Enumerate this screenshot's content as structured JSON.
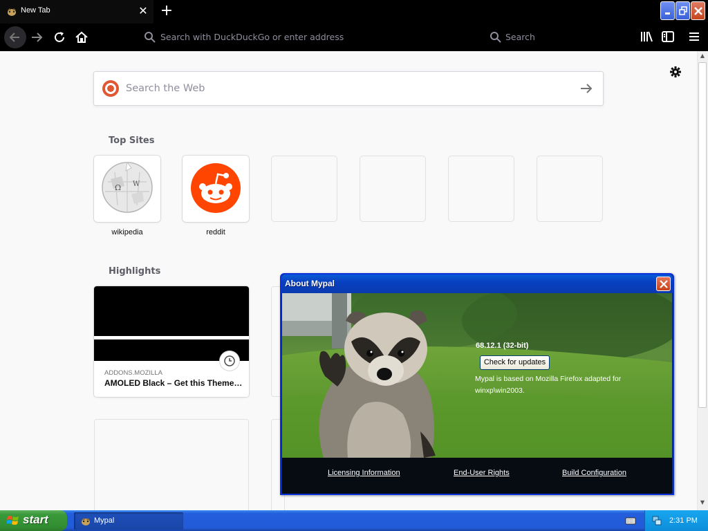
{
  "browser": {
    "tab_title": "New Tab",
    "urlbar_placeholder": "Search with DuckDuckGo or enter address",
    "searchbar_placeholder": "Search",
    "icons": [
      "back-icon",
      "forward-icon",
      "reload-icon",
      "home-icon",
      "library-icon",
      "sidebar-icon",
      "menu-icon"
    ]
  },
  "newtab": {
    "search_placeholder": "Search the Web",
    "top_sites_title": "Top Sites",
    "highlights_title": "Highlights",
    "top_sites": [
      {
        "label": "wikipedia"
      },
      {
        "label": "reddit"
      },
      {
        "label": ""
      },
      {
        "label": ""
      },
      {
        "label": ""
      },
      {
        "label": ""
      }
    ],
    "highlight_card": {
      "source": "ADDONS.MOZILLA",
      "title": "AMOLED Black – Get this Theme…"
    }
  },
  "about_dialog": {
    "title": "About Mypal",
    "version": "68.12.1 (32-bit)",
    "check_button": "Check for updates",
    "description": "Mypal is based on Mozilla Firefox adapted for winxp\\win2003.",
    "links": [
      "Licensing Information",
      "End-User Rights",
      "Build Configuration"
    ]
  },
  "taskbar": {
    "start_label": "start",
    "task_label": "Mypal",
    "clock": "2:31 PM"
  },
  "colors": {
    "reddit": "#ff4500",
    "duckduckgo": "#de5833",
    "xp_blue": "#245edc",
    "xp_green": "#3a9a3a"
  }
}
